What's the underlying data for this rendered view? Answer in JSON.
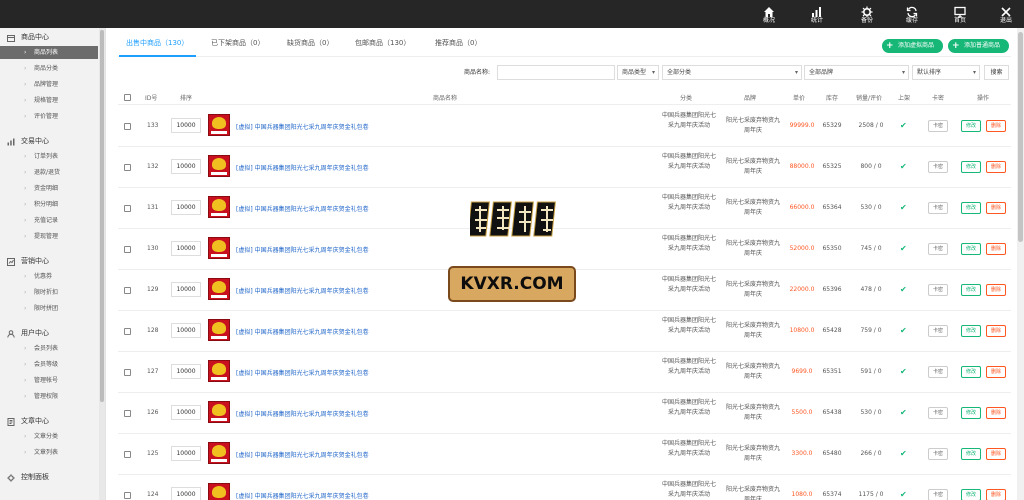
{
  "topbar": {
    "items": [
      {
        "label": "概况",
        "icon": "home-icon"
      },
      {
        "label": "统计",
        "icon": "bar-chart-icon"
      },
      {
        "label": "备份",
        "icon": "cog-icon"
      },
      {
        "label": "缓存",
        "icon": "refresh-icon"
      },
      {
        "label": "首页",
        "icon": "monitor-icon"
      },
      {
        "label": "退出",
        "icon": "close-icon"
      }
    ]
  },
  "sidebar": {
    "groups": [
      {
        "label": "商品中心",
        "icon": "goods-icon",
        "items": [
          "商品列表",
          "商品分类",
          "品牌管理",
          "规格管理",
          "评价管理"
        ]
      },
      {
        "label": "交易中心",
        "icon": "trade-chart-icon",
        "items": [
          "订单列表",
          "退款/退货",
          "资金明细",
          "积分明细",
          "充值记录",
          "提现管理"
        ]
      },
      {
        "label": "营销中心",
        "icon": "marketing-icon",
        "items": [
          "优惠券",
          "限时折扣",
          "限时拼团"
        ]
      },
      {
        "label": "用户中心",
        "icon": "user-icon",
        "items": [
          "会员列表",
          "会员等级",
          "管理帐号",
          "管理权限"
        ]
      },
      {
        "label": "文章中心",
        "icon": "article-icon",
        "items": [
          "文章分类",
          "文章列表"
        ]
      },
      {
        "label": "控制面板",
        "icon": "control-panel-icon",
        "items": []
      }
    ],
    "active_item": "商品列表"
  },
  "tabs": [
    {
      "label": "出售中商品（130）",
      "active": true
    },
    {
      "label": "已下架商品（0）",
      "active": false
    },
    {
      "label": "缺货商品（0）",
      "active": false
    },
    {
      "label": "包邮商品（130）",
      "active": false
    },
    {
      "label": "推荐商品（0）",
      "active": false
    }
  ],
  "actions": {
    "add_virtual": "添加虚拟商品",
    "add_normal": "添加普通商品"
  },
  "filters": {
    "name_label": "商品名称:",
    "name_value": "",
    "type_value": "商品类型",
    "category_value": "全部分类",
    "brand_value": "全部品牌",
    "sort_value": "默认排序",
    "search_label": "搜索"
  },
  "table": {
    "headers": {
      "id": "ID号",
      "sort": "排序",
      "name": "商品名称",
      "category": "分类",
      "brand": "品牌",
      "price": "单价",
      "stock": "库存",
      "sales": "销量/评价",
      "on_shelf": "上架",
      "card": "卡密",
      "ops": "操作"
    },
    "buttons": {
      "card": "卡密",
      "edit": "修改",
      "delete": "删除"
    },
    "rows": [
      {
        "id": "133",
        "sort": "10000",
        "name": "[虚拟] 中国兵器集团阳光七采九周年庆贺金礼包卷",
        "category": "中国兵器集团阳光七采九周年庆活动",
        "brand": "阳光七采废弃物资九周年庆",
        "price": "99999.0",
        "stock": "65329",
        "sales": "2508 / 0"
      },
      {
        "id": "132",
        "sort": "10000",
        "name": "[虚拟] 中国兵器集团阳光七采九周年庆贺金礼包卷",
        "category": "中国兵器集团阳光七采九周年庆活动",
        "brand": "阳光七采废弃物资九周年庆",
        "price": "88000.0",
        "stock": "65325",
        "sales": "800 / 0"
      },
      {
        "id": "131",
        "sort": "10000",
        "name": "[虚拟] 中国兵器集团阳光七采九周年庆贺金礼包卷",
        "category": "中国兵器集团阳光七采九周年庆活动",
        "brand": "阳光七采废弃物资九周年庆",
        "price": "66000.0",
        "stock": "65364",
        "sales": "530 / 0"
      },
      {
        "id": "130",
        "sort": "10000",
        "name": "[虚拟] 中国兵器集团阳光七采九周年庆贺金礼包卷",
        "category": "中国兵器集团阳光七采九周年庆活动",
        "brand": "阳光七采废弃物资九周年庆",
        "price": "52000.0",
        "stock": "65350",
        "sales": "745 / 0"
      },
      {
        "id": "129",
        "sort": "10000",
        "name": "[虚拟] 中国兵器集团阳光七采九周年庆贺金礼包卷",
        "category": "中国兵器集团阳光七采九周年庆活动",
        "brand": "阳光七采废弃物资九周年庆",
        "price": "22000.0",
        "stock": "65396",
        "sales": "478 / 0"
      },
      {
        "id": "128",
        "sort": "10000",
        "name": "[虚拟] 中国兵器集团阳光七采九周年庆贺金礼包卷",
        "category": "中国兵器集团阳光七采九周年庆活动",
        "brand": "阳光七采废弃物资九周年庆",
        "price": "10800.0",
        "stock": "65428",
        "sales": "759 / 0"
      },
      {
        "id": "127",
        "sort": "10000",
        "name": "[虚拟] 中国兵器集团阳光七采九周年庆贺金礼包卷",
        "category": "中国兵器集团阳光七采九周年庆活动",
        "brand": "阳光七采废弃物资九周年庆",
        "price": "9699.0",
        "stock": "65351",
        "sales": "591 / 0"
      },
      {
        "id": "126",
        "sort": "10000",
        "name": "[虚拟] 中国兵器集团阳光七采九周年庆贺金礼包卷",
        "category": "中国兵器集团阳光七采九周年庆活动",
        "brand": "阳光七采废弃物资九周年庆",
        "price": "5500.0",
        "stock": "65438",
        "sales": "530 / 0"
      },
      {
        "id": "125",
        "sort": "10000",
        "name": "[虚拟] 中国兵器集团阳光七采九周年庆贺金礼包卷",
        "category": "中国兵器集团阳光七采九周年庆活动",
        "brand": "阳光七采废弃物资九周年庆",
        "price": "3300.0",
        "stock": "65480",
        "sales": "266 / 0"
      },
      {
        "id": "124",
        "sort": "10000",
        "name": "[虚拟] 中国兵器集团阳光七采九周年庆贺金礼包卷",
        "category": "中国兵器集团阳光七采九周年庆活动",
        "brand": "阳光七采废弃物资九周年庆",
        "price": "1080.0",
        "stock": "65374",
        "sales": "1175 / 0"
      }
    ]
  },
  "watermark": {
    "logo_text": "南丘科技",
    "banner_text": "KVXR.COM"
  },
  "colors": {
    "accent": "#1e9fff",
    "green": "#16b777",
    "price": "#ff5722",
    "topbar": "#262626"
  }
}
